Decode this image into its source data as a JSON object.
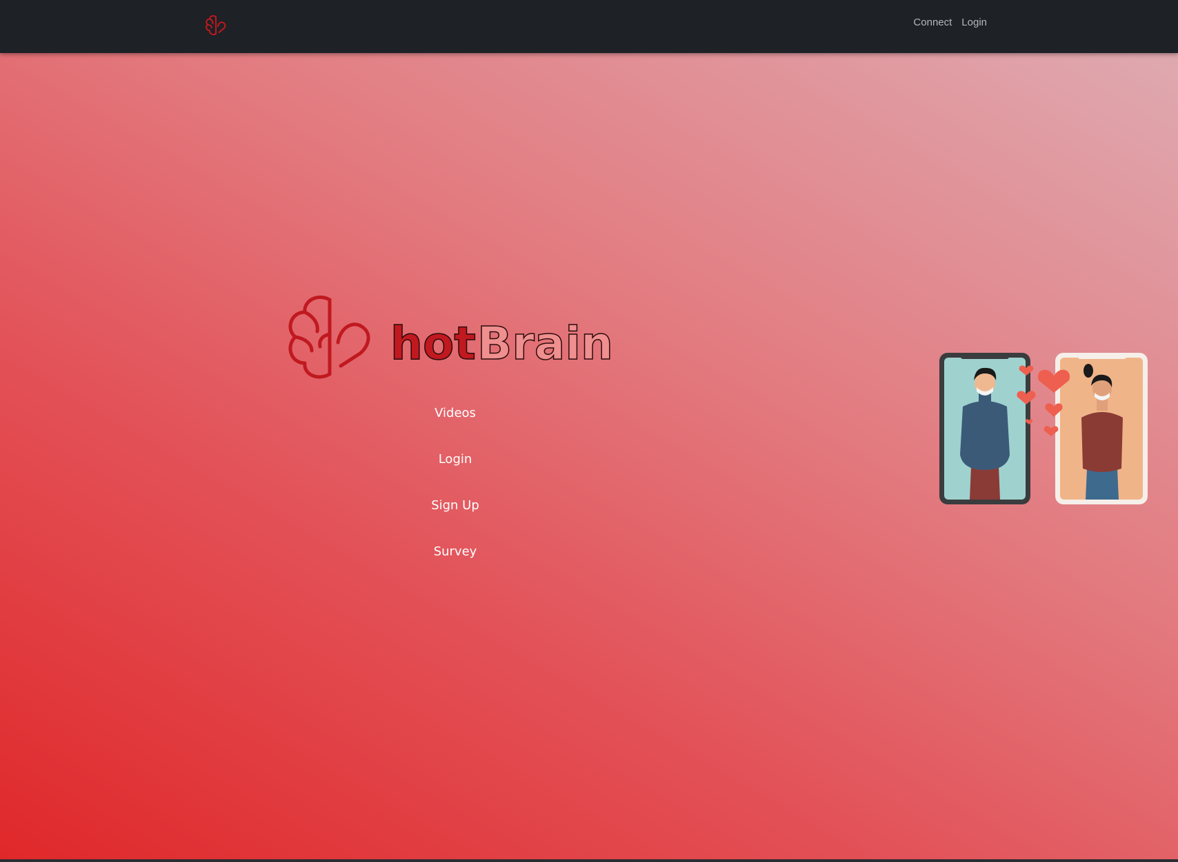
{
  "navbar": {
    "logo_icon": "brain-heart-icon",
    "links": [
      {
        "label": "Connect"
      },
      {
        "label": "Login"
      }
    ]
  },
  "hero": {
    "brand_icon": "brain-heart-icon",
    "brand_part1": "hot",
    "brand_part2": "Brain",
    "menu": [
      {
        "label": "Videos"
      },
      {
        "label": "Login"
      },
      {
        "label": "Sign Up"
      },
      {
        "label": "Survey"
      }
    ],
    "illustration": "video-dating-phones-illustration"
  },
  "colors": {
    "navbar_bg": "#1e2126",
    "accent_red": "#c0191f",
    "gradient_start": "#e0282a",
    "gradient_end": "#dfa9b0"
  }
}
